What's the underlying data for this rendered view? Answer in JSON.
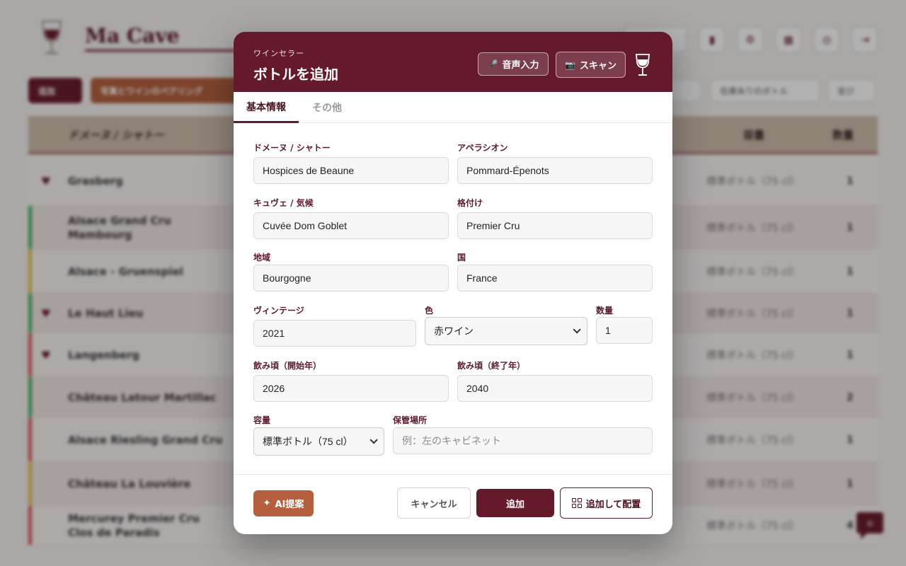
{
  "app": {
    "title": "Ma Cave",
    "toolbar": {
      "button1": "追加",
      "button2": "写真とワインのペアリング",
      "select1": "",
      "select2": "在庫ありのボトル",
      "select3": "並び"
    },
    "table": {
      "col_domain": "ドメーヌ / シャトー",
      "col_format": "容量",
      "col_qty": "数量",
      "rows": [
        {
          "name": "Grasberg",
          "format": "標準ボトル（75 cl）",
          "qty": "1",
          "color": "",
          "heart": true
        },
        {
          "name": "Alsace Grand Cru Mambourg",
          "format": "標準ボトル（75 cl）",
          "qty": "1",
          "color": "#4caf6e",
          "heart": false
        },
        {
          "name": "Alsace - Gruenspiel",
          "format": "標準ボトル（75 cl）",
          "qty": "1",
          "color": "#e3c14d",
          "heart": false
        },
        {
          "name": "Le Haut Lieu",
          "format": "標準ボトル（75 cl）",
          "qty": "1",
          "color": "#4caf6e",
          "heart": true
        },
        {
          "name": "Langenberg",
          "format": "標準ボトル（75 cl）",
          "qty": "1",
          "color": "#e05a5a",
          "heart": true
        },
        {
          "name": "Château Latour Martillac",
          "format": "標準ボトル（75 cl）",
          "qty": "2",
          "color": "#4caf6e",
          "heart": false
        },
        {
          "name": "Alsace Riesling Grand Cru",
          "format": "標準ボトル（75 cl）",
          "qty": "1",
          "color": "#e05a5a",
          "heart": false
        },
        {
          "name": "Château La Louvière",
          "format": "標準ボトル（75 cl）",
          "qty": "1",
          "color": "#e3c14d",
          "heart": false
        },
        {
          "name": "Mercurey Premier Cru Clos de Paradis",
          "format": "標準ボトル（75 cl）",
          "qty": "4",
          "color": "#e05a5a",
          "heart": false
        }
      ]
    }
  },
  "modal": {
    "subtitle": "ワインセラー",
    "title": "ボトルを追加",
    "voice_button": "音声入力",
    "scan_button": "スキャン",
    "tabs": {
      "basic": "基本情報",
      "other": "その他"
    },
    "fields": {
      "domain": {
        "label": "ドメーヌ / シャトー",
        "value": "Hospices de Beaune"
      },
      "appellation": {
        "label": "アペラシオン",
        "value": "Pommard-Épenots"
      },
      "cuvee": {
        "label": "キュヴェ / 気候",
        "value": "Cuvée Dom Goblet"
      },
      "classification": {
        "label": "格付け",
        "value": "Premier Cru"
      },
      "region": {
        "label": "地域",
        "value": "Bourgogne"
      },
      "country": {
        "label": "国",
        "value": "France"
      },
      "vintage": {
        "label": "ヴィンテージ",
        "value": "2021"
      },
      "color": {
        "label": "色",
        "value": "赤ワイン"
      },
      "quantity": {
        "label": "数量",
        "value": "1"
      },
      "drink_from": {
        "label": "飲み頃（開始年）",
        "value": "2026"
      },
      "drink_to": {
        "label": "飲み頃（終了年）",
        "value": "2040"
      },
      "format": {
        "label": "容量",
        "value": "標準ボトル（75 cl）"
      },
      "location": {
        "label": "保管場所",
        "value": "",
        "placeholder": "例：左のキャビネット"
      }
    },
    "footer": {
      "ai_button": "AI提案",
      "cancel_button": "キャンセル",
      "add_button": "追加",
      "add_place_button": "追加して配置"
    }
  },
  "colors": {
    "wine": "#641a2b",
    "terracotta": "#b4603f"
  }
}
